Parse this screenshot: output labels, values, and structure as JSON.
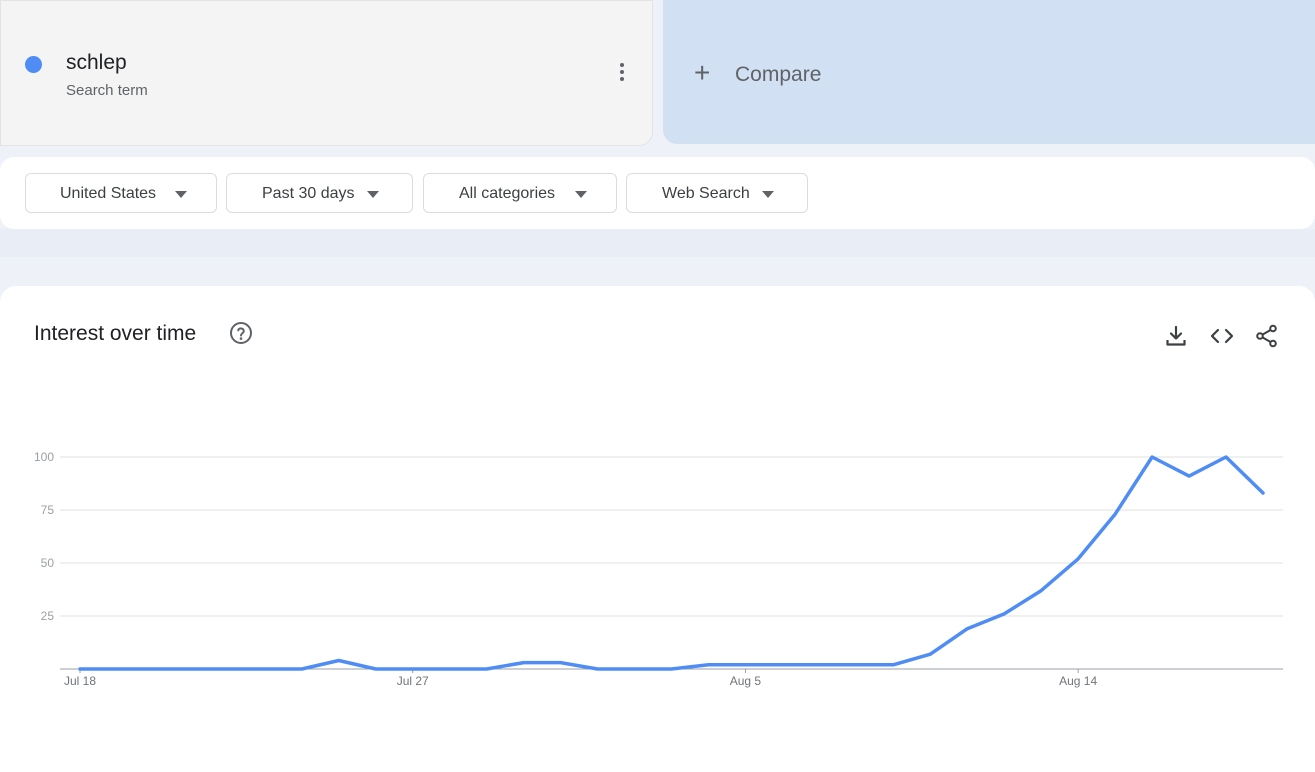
{
  "term": {
    "name": "schlep",
    "subtitle": "Search term",
    "color": "#4f8df5",
    "more_icon": "more-vert-icon"
  },
  "compare": {
    "icon": "plus-icon",
    "label": "Compare"
  },
  "filters": [
    {
      "label": "United States",
      "icon": "caret-down-icon"
    },
    {
      "label": "Past 30 days",
      "icon": "caret-down-icon"
    },
    {
      "label": "All categories",
      "icon": "caret-down-icon"
    },
    {
      "label": "Web Search",
      "icon": "caret-down-icon"
    }
  ],
  "chart_section": {
    "title": "Interest over time",
    "help_icon": "help-circle-icon",
    "tools": [
      "download-icon",
      "embed-code-icon",
      "share-icon"
    ]
  },
  "chart_data": {
    "type": "line",
    "title": "Interest over time",
    "xlabel": "",
    "ylabel": "",
    "ylim": [
      0,
      100
    ],
    "yticks": [
      25,
      50,
      75,
      100
    ],
    "xtick_labels": [
      "Jul 18",
      "Jul 27",
      "Aug 5",
      "Aug 14"
    ],
    "xtick_index": [
      0,
      9,
      18,
      27
    ],
    "grid": true,
    "legend": "none",
    "series": [
      {
        "color": "#4f8df5",
        "x": [
          "Jul 18",
          "Jul 19",
          "Jul 20",
          "Jul 21",
          "Jul 22",
          "Jul 23",
          "Jul 24",
          "Jul 25",
          "Jul 26",
          "Jul 27",
          "Jul 28",
          "Jul 29",
          "Jul 30",
          "Jul 31",
          "Aug 1",
          "Aug 2",
          "Aug 3",
          "Aug 4",
          "Aug 5",
          "Aug 6",
          "Aug 7",
          "Aug 8",
          "Aug 9",
          "Aug 10",
          "Aug 11",
          "Aug 12",
          "Aug 13",
          "Aug 14",
          "Aug 15",
          "Aug 16",
          "Aug 17",
          "Aug 18",
          "Aug 19"
        ],
        "values": [
          0,
          0,
          0,
          0,
          0,
          0,
          0,
          4,
          0,
          0,
          0,
          0,
          3,
          3,
          0,
          0,
          0,
          2,
          2,
          2,
          2,
          2,
          2,
          7,
          19,
          26,
          37,
          52,
          73,
          100,
          91,
          100,
          83
        ]
      }
    ]
  }
}
